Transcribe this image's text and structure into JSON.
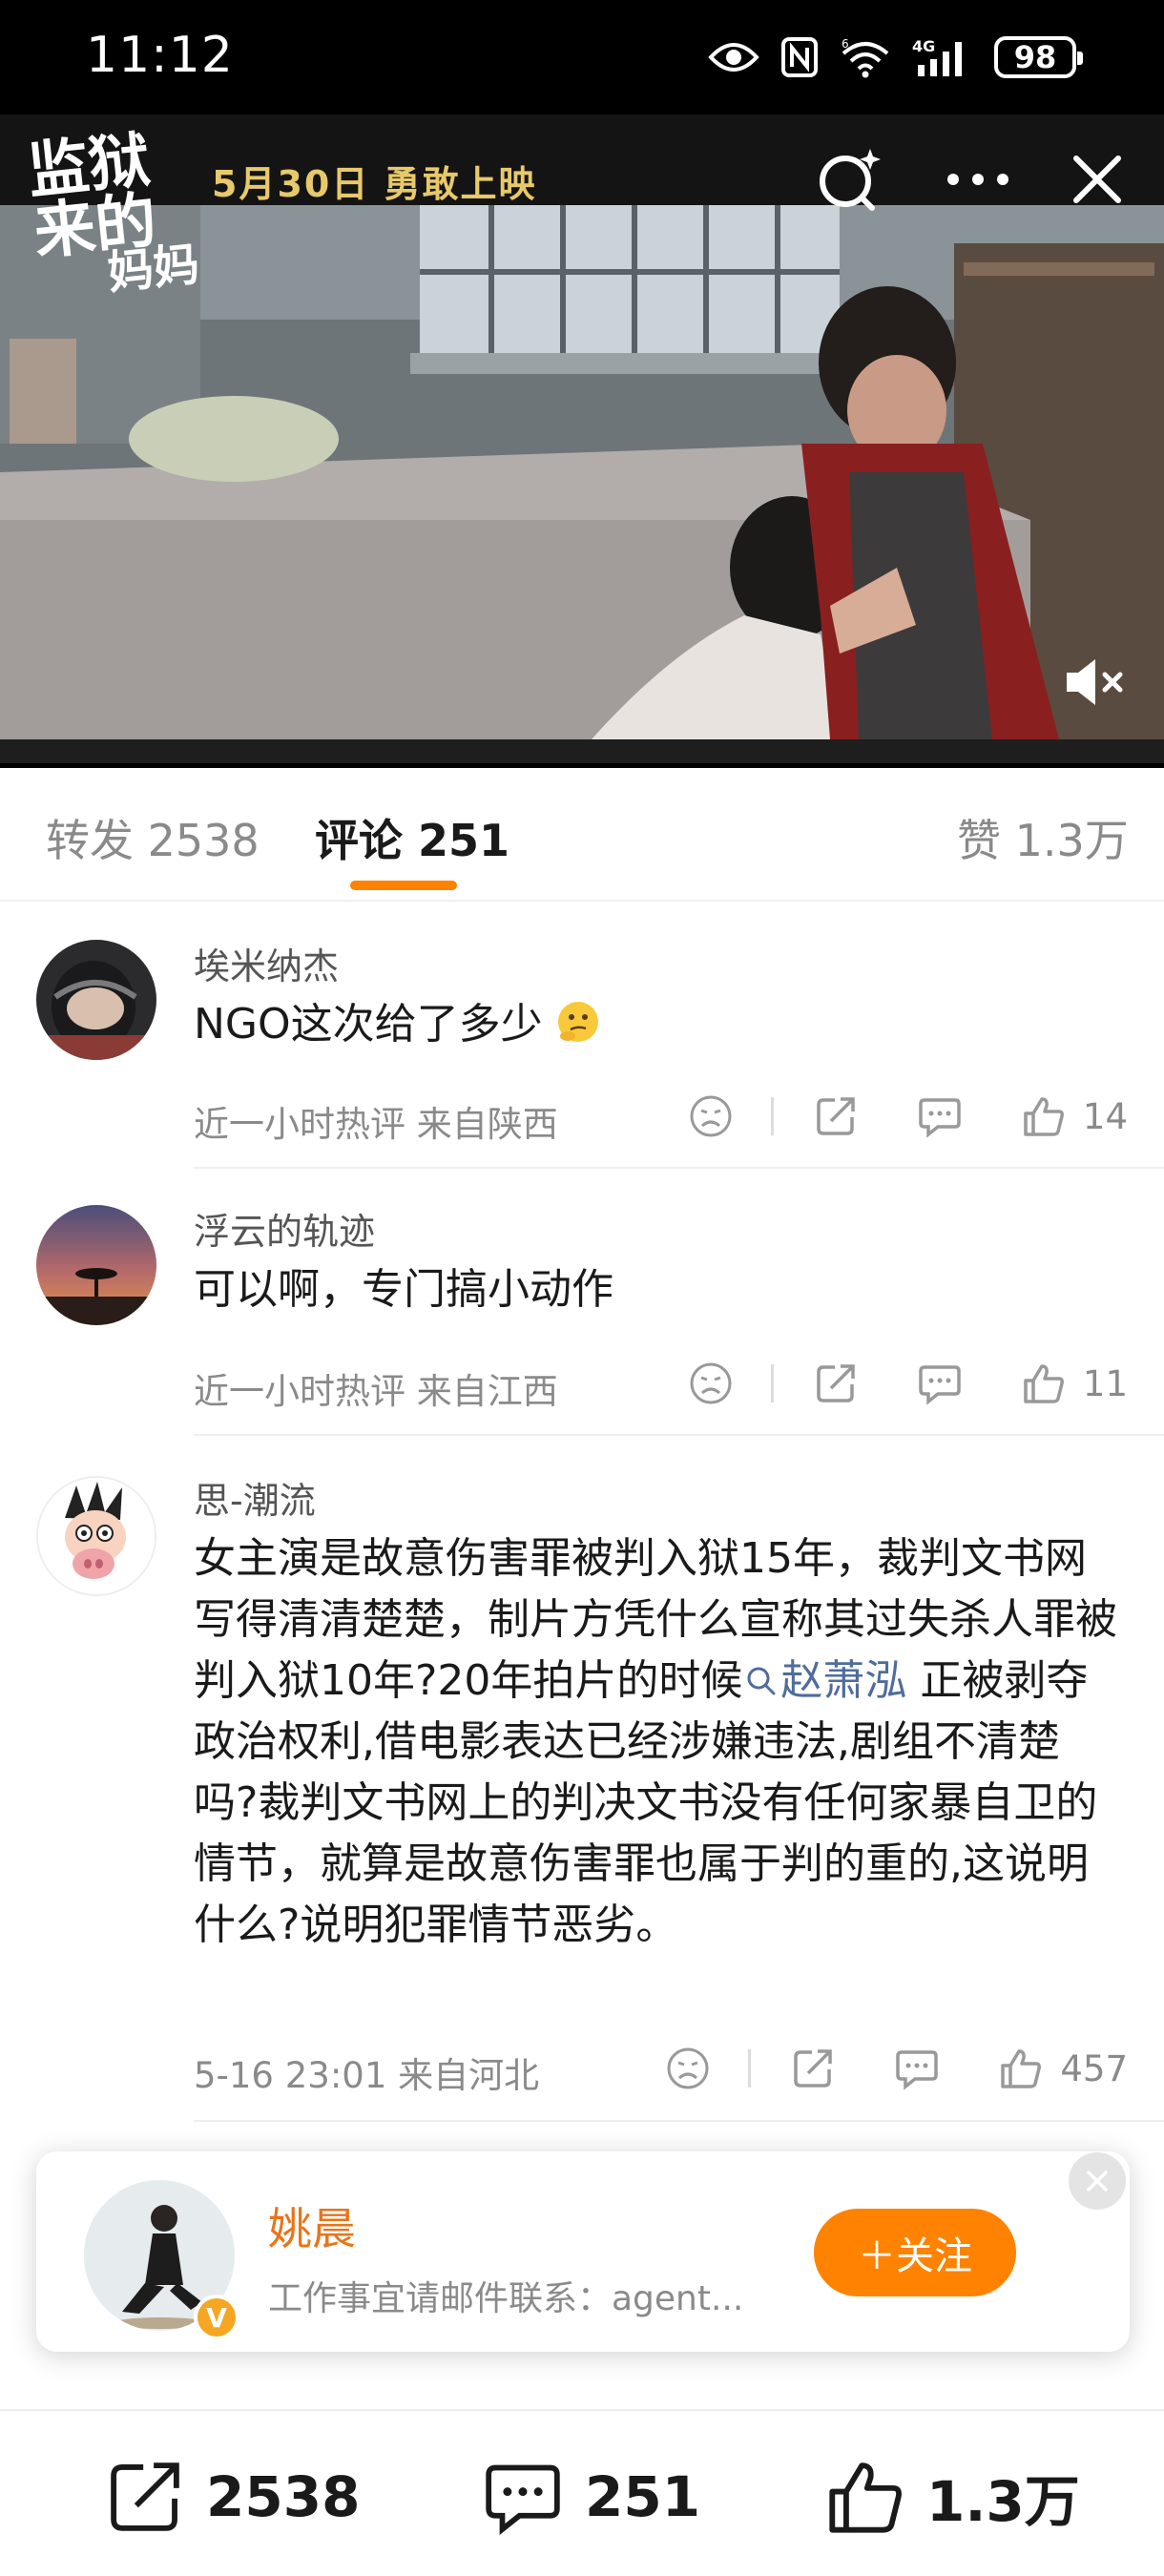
{
  "status_bar": {
    "time": "11:12",
    "battery": "98",
    "network": "4G",
    "wifi_label": "6"
  },
  "video": {
    "logo_line1": "监狱来的",
    "logo_line2": "妈妈",
    "premiere_text": "5月30日 勇敢上映",
    "icons": [
      "search-icon",
      "more-icon",
      "close-icon",
      "mute-icon"
    ]
  },
  "tabs": [
    {
      "label": "转发 2538"
    },
    {
      "label": "评论 251"
    },
    {
      "label": "赞 1.3万"
    }
  ],
  "comments": [
    {
      "name": "埃米纳杰",
      "text": "NGO这次给了多少",
      "emoji": "thinking-face",
      "meta": "近一小时热评  来自陕西",
      "likes": "14"
    },
    {
      "name": "浮云的轨迹",
      "text": "可以啊，专门搞小动作",
      "meta": "近一小时热评  来自江西",
      "likes": "11"
    },
    {
      "name": "思-潮流",
      "text_before": "女主演是故意伤害罪被判入狱15年，裁判文书网写得清清楚楚，制片方凭什么宣称其过失杀人罪被判入狱10年?20年拍片的时候",
      "link": "赵萧泓",
      "text_after": " 正被剥夺政治权利,借电影表达已经涉嫌违法,剧组不清楚吗?裁判文书网上的判决文书没有任何家暴自卫的情节，就算是故意伤害罪也属于判的重的,这说明什么?说明犯罪情节恶劣。",
      "meta": "5-16 23:01  来自河北",
      "likes": "457"
    }
  ],
  "follow_card": {
    "name": "姚晨",
    "desc": "工作事宜请邮件联系：agent...",
    "button": "＋关注",
    "badge": "V"
  },
  "bottom_bar": {
    "repost": "2538",
    "comment": "251",
    "like": "1.3万"
  },
  "colors": {
    "accent": "#ff8200",
    "link": "#4f6c9c",
    "name_orange": "#e8751a"
  }
}
